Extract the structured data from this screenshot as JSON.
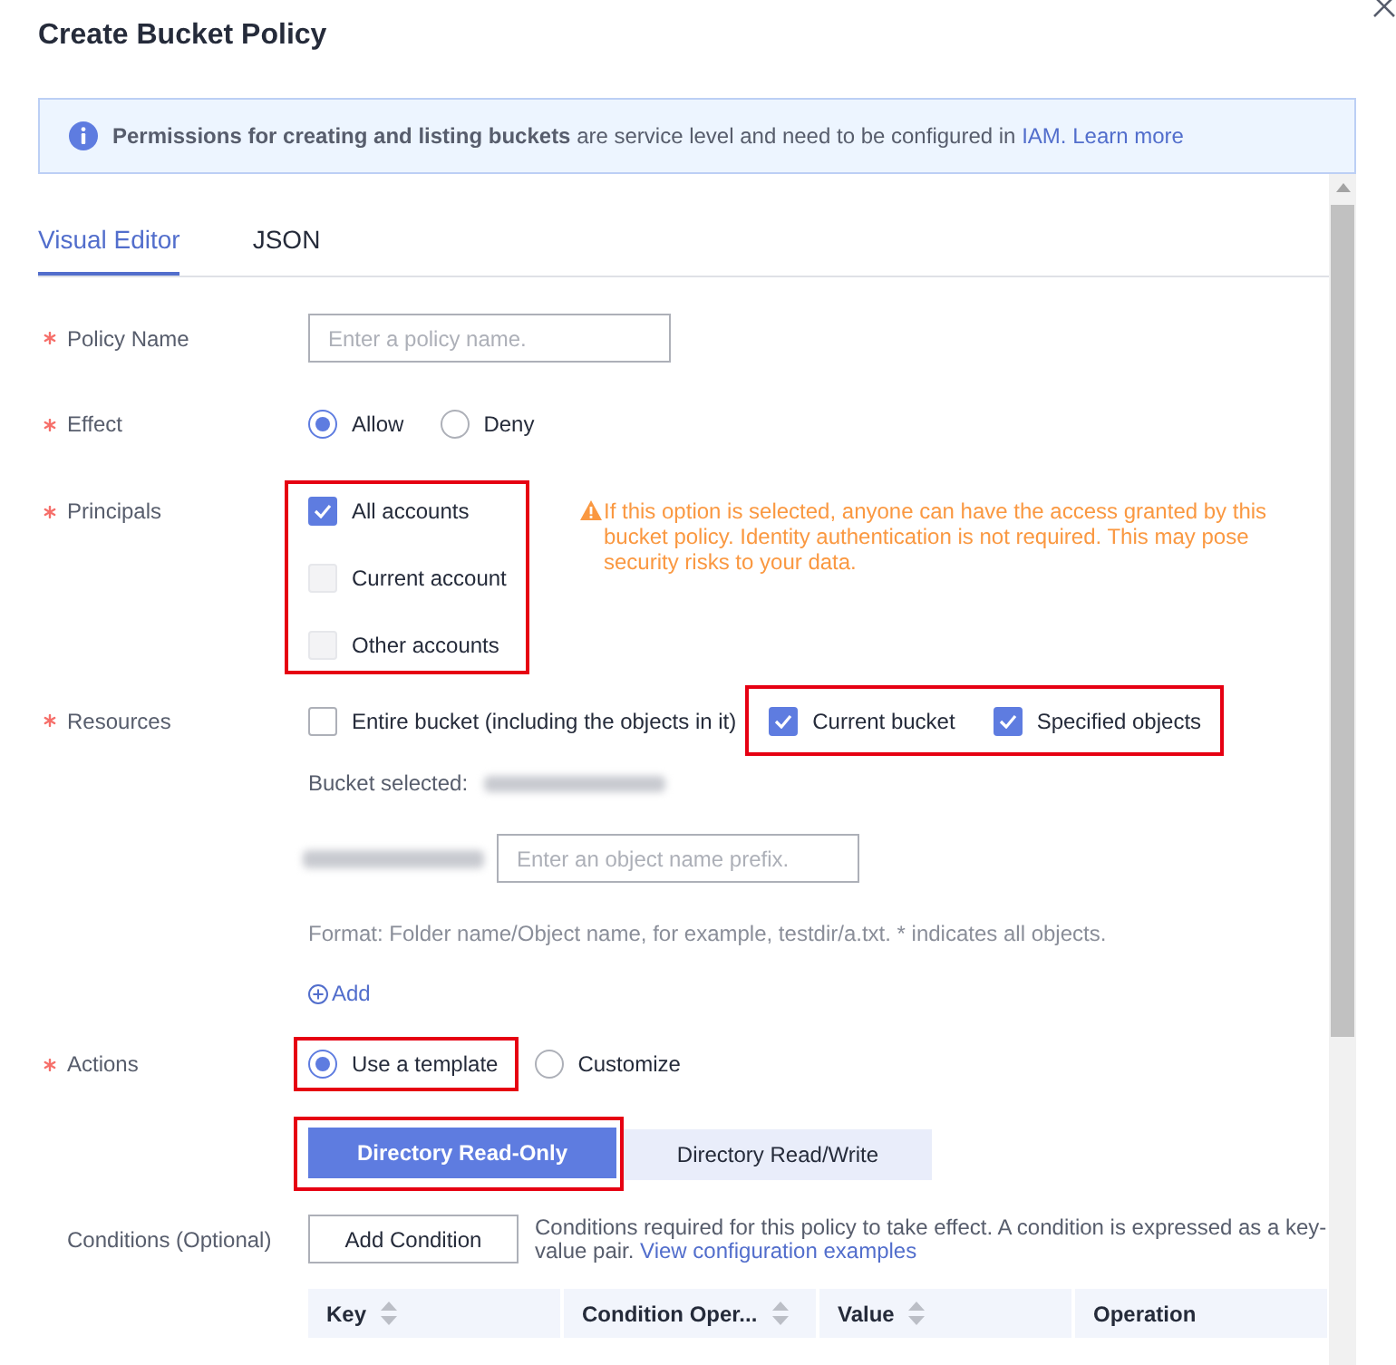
{
  "dialog": {
    "title": "Create Bucket Policy"
  },
  "notice": {
    "text": "**Permissions for creating and listing buckets** are service level and need to be configured in",
    "links": [
      "IAM.",
      "Learn more"
    ]
  },
  "tabs": [
    {
      "label": "Visual Editor",
      "selected": true
    },
    {
      "label": "JSON",
      "selected": false
    }
  ],
  "form": {
    "policy_name": {
      "label": "Policy Name",
      "required": true,
      "placeholder": "Enter a policy name."
    },
    "effect": {
      "label": "Effect",
      "required": true,
      "options": [
        {
          "label": "Allow",
          "selected": true
        },
        {
          "label": "Deny",
          "selected": false
        }
      ]
    },
    "principals": {
      "label": "Principals",
      "required": true,
      "highlighted": true,
      "options": [
        {
          "label": "All accounts",
          "checked": true,
          "disabled": false
        },
        {
          "label": "Current account",
          "checked": false,
          "disabled": true
        },
        {
          "label": "Other accounts",
          "checked": false,
          "disabled": true
        }
      ],
      "warning": "If this option is selected, anyone can have the access granted by this bucket policy. Identity authentication is not required. This may pose security risks to your data."
    },
    "resources": {
      "label": "Resources",
      "required": true,
      "option_groups": [
        {
          "highlighted": false,
          "options": [
            {
              "label": "Entire bucket (including the objects in it)",
              "checked": false
            }
          ]
        },
        {
          "highlighted": true,
          "options": [
            {
              "label": "Current bucket",
              "checked": true
            },
            {
              "label": "Specified objects",
              "checked": true
            }
          ]
        }
      ],
      "bucket_selected_label": "Bucket selected:",
      "prefix_placeholder": "Enter an object name prefix.",
      "format_hint": "Format: Folder name/Object name, for example, testdir/a.txt. * indicates all objects.",
      "add_label": "Add"
    },
    "actions": {
      "label": "Actions",
      "required": true,
      "options": [
        {
          "label": "Use a template",
          "selected": true,
          "highlighted": true
        },
        {
          "label": "Customize",
          "selected": false,
          "highlighted": false
        }
      ],
      "templates": [
        {
          "label": "Directory Read-Only",
          "selected": true,
          "highlighted": true
        },
        {
          "label": "Directory Read/Write",
          "selected": false,
          "highlighted": false
        }
      ]
    },
    "conditions": {
      "label": "Conditions (Optional)",
      "required": false,
      "button": "Add Condition",
      "description": "Conditions required for this policy to take effect. A condition is expressed as a key-value pair.",
      "link": "View configuration examples",
      "columns": [
        {
          "label": "Key",
          "sortable": true
        },
        {
          "label": "Condition Oper...",
          "sortable": true
        },
        {
          "label": "Value",
          "sortable": true
        },
        {
          "label": "Operation",
          "sortable": false
        }
      ]
    }
  }
}
